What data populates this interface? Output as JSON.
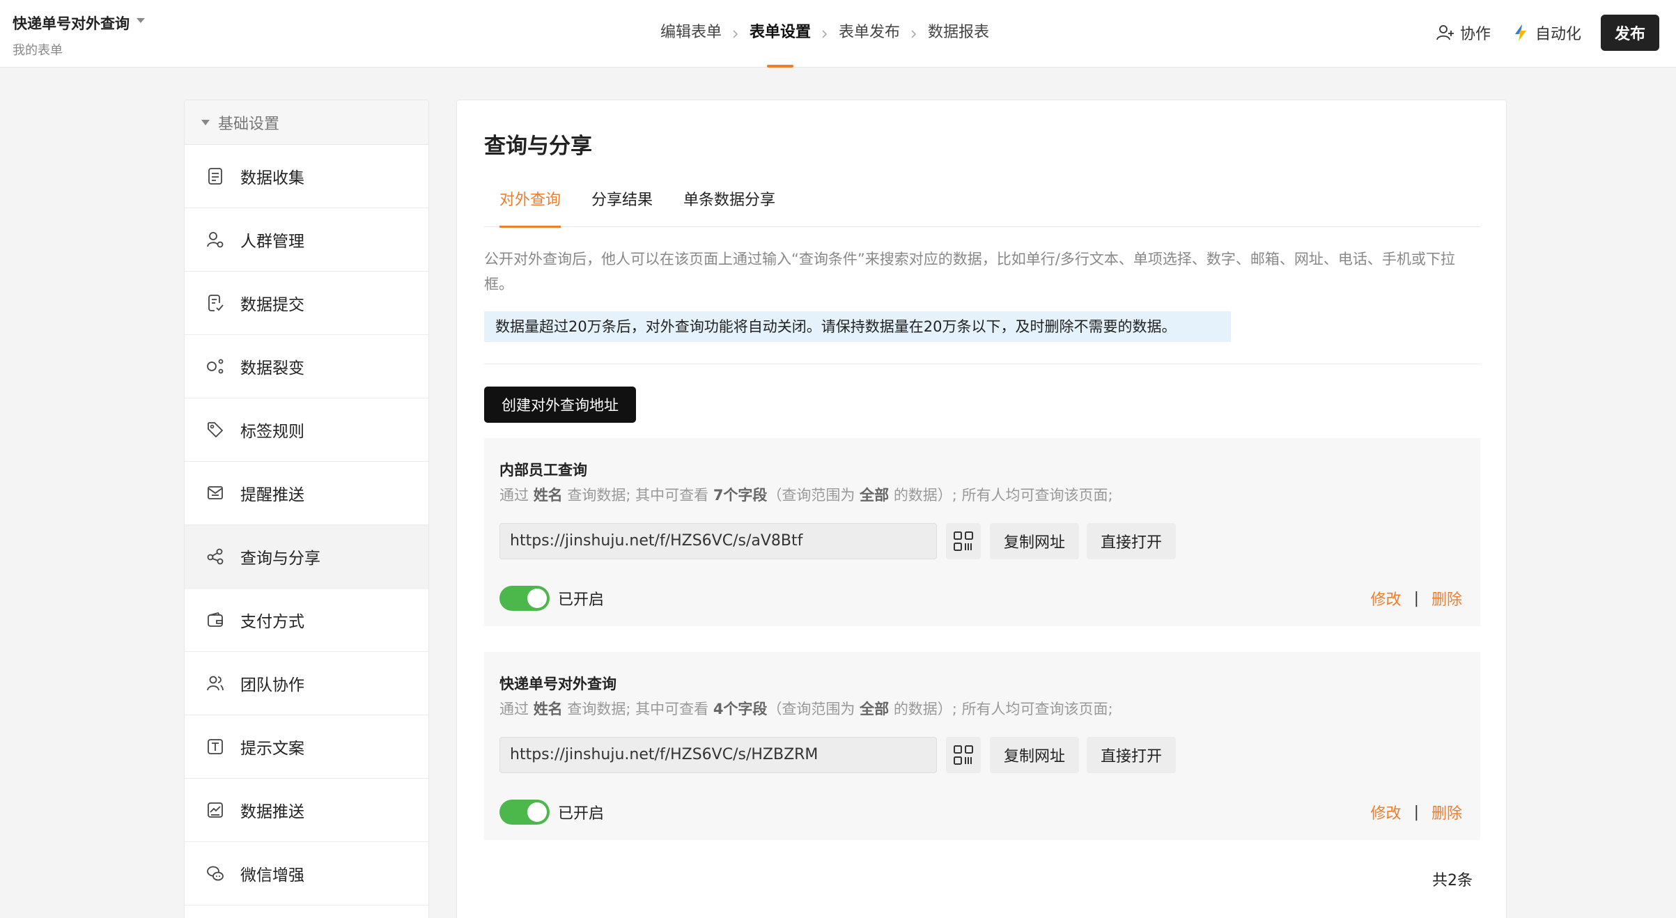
{
  "header": {
    "form_title": "快递单号对外查询",
    "form_subtitle": "我的表单",
    "steps": [
      "编辑表单",
      "表单设置",
      "表单发布",
      "数据报表"
    ],
    "collaborate": "协作",
    "automation": "自动化",
    "publish": "发布",
    "accent": "#f07d2b"
  },
  "sidebar": {
    "section": "基础设置",
    "items": [
      {
        "label": "数据收集",
        "icon": "document-icon"
      },
      {
        "label": "人群管理",
        "icon": "people-settings-icon"
      },
      {
        "label": "数据提交",
        "icon": "document-check-icon"
      },
      {
        "label": "数据裂变",
        "icon": "fission-icon"
      },
      {
        "label": "标签规则",
        "icon": "tag-icon"
      },
      {
        "label": "提醒推送",
        "icon": "reminder-icon"
      },
      {
        "label": "查询与分享",
        "icon": "share-icon"
      },
      {
        "label": "支付方式",
        "icon": "wallet-icon"
      },
      {
        "label": "团队协作",
        "icon": "team-icon"
      },
      {
        "label": "提示文案",
        "icon": "text-icon"
      },
      {
        "label": "数据推送",
        "icon": "chart-push-icon"
      },
      {
        "label": "微信增强",
        "icon": "wechat-icon"
      }
    ]
  },
  "main": {
    "title": "查询与分享",
    "tabs": [
      "对外查询",
      "分享结果",
      "单条数据分享"
    ],
    "description": "公开对外查询后，他人可以在该页面上通过输入“查询条件”来搜索对应的数据，比如单行/多行文本、单项选择、数字、邮箱、网址、电话、手机或下拉框。",
    "notice": "数据量超过20万条后，对外查询功能将自动关闭。请保持数据量在20万条以下，及时删除不需要的数据。",
    "create_button": "创建对外查询地址",
    "cards": [
      {
        "title": "内部员工查询",
        "desc_1": "通过",
        "field": "姓名",
        "desc_2": "查询数据; 其中可查看",
        "count": "7个字段",
        "desc_3": "（查询范围为",
        "scope": "全部",
        "desc_4": "的数据）; 所有人均可查询该页面;",
        "url": "https://jinshuju.net/f/HZS6VC/s/aV8Btf",
        "copy": "复制网址",
        "open": "直接打开",
        "status": "已开启",
        "edit": "修改",
        "sep": "|",
        "delete": "删除"
      },
      {
        "title": "快递单号对外查询",
        "desc_1": "通过",
        "field": "姓名",
        "desc_2": "查询数据; 其中可查看",
        "count": "4个字段",
        "desc_3": "（查询范围为",
        "scope": "全部",
        "desc_4": "的数据）; 所有人均可查询该页面;",
        "url": "https://jinshuju.net/f/HZS6VC/s/HZBZRM",
        "copy": "复制网址",
        "open": "直接打开",
        "status": "已开启",
        "edit": "修改",
        "sep": "|",
        "delete": "删除"
      }
    ],
    "total": "共2条"
  }
}
